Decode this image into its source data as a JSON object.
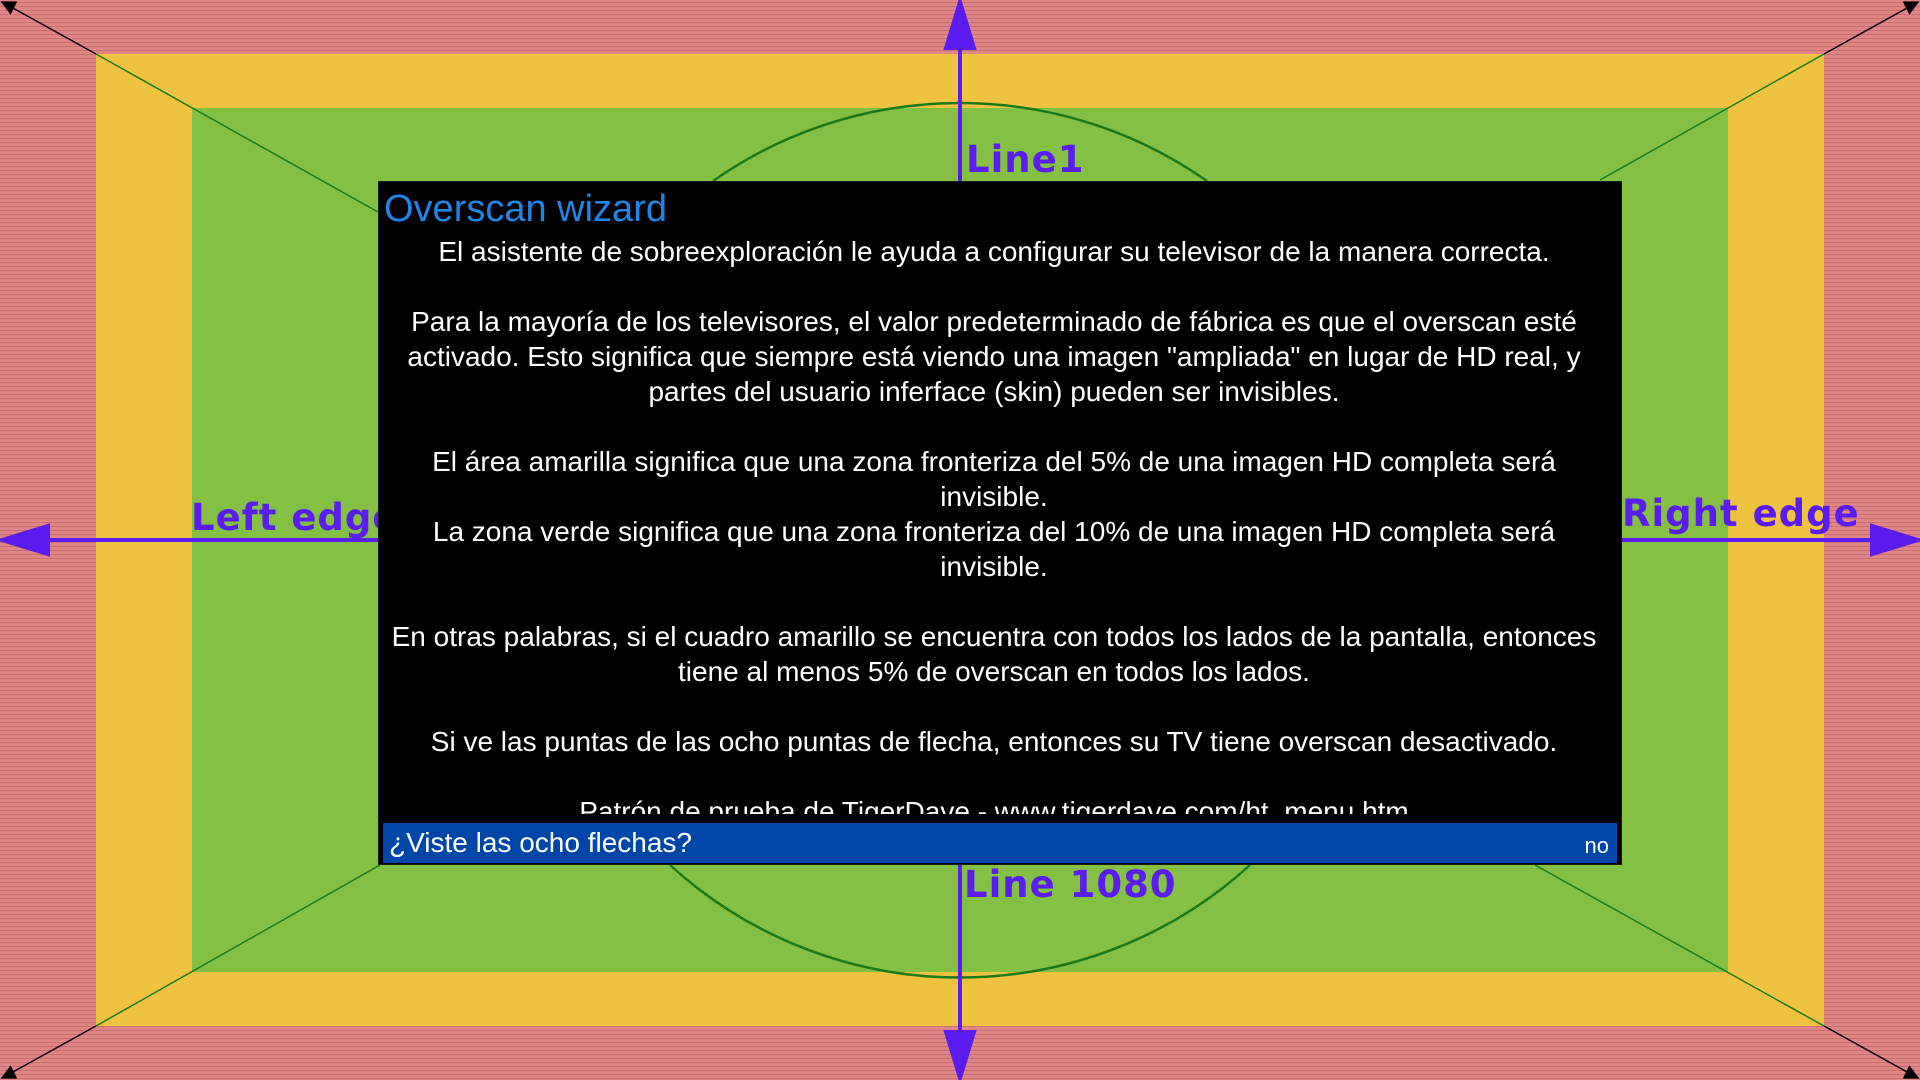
{
  "pattern": {
    "labels": {
      "top": "Line1",
      "bottom": "Line 1080",
      "left": "Left edge",
      "right": "Right edge"
    },
    "colors": {
      "outer": "#e08585",
      "yellow": "#efc33f",
      "green": "#84c044",
      "arrows": "#5a1cf0",
      "lines": "#1a7a1a"
    }
  },
  "dialog": {
    "title": "Overscan wizard",
    "paragraphs": [
      "El asistente de sobreexploración le ayuda a configurar su televisor de la manera correcta.",
      "Para la mayoría de los televisores, el valor predeterminado de fábrica es que el overscan esté activado. Esto significa que siempre está viendo una imagen \"ampliada\" en lugar de HD real, y partes del usuario inferface (skin) pueden ser invisibles.",
      "El área amarilla significa que una zona fronteriza del 5% de una imagen HD completa será invisible.",
      "La zona verde significa que una zona fronteriza del 10% de una imagen HD completa será invisible.",
      "En otras palabras, si el cuadro amarillo se encuentra con todos los lados de la pantalla, entonces tiene al menos 5% de overscan en todos los lados.",
      "Si ve las puntas de las ocho puntas de flecha, entonces su TV tiene overscan desactivado.",
      "Patrón de prueba de TigerDave - www.tigerdave.com/ht_menu.htm"
    ],
    "question": "¿Viste las ocho flechas?",
    "answer": "no",
    "colors": {
      "title": "#1f86e6",
      "question_bar": "#0046a8"
    }
  }
}
